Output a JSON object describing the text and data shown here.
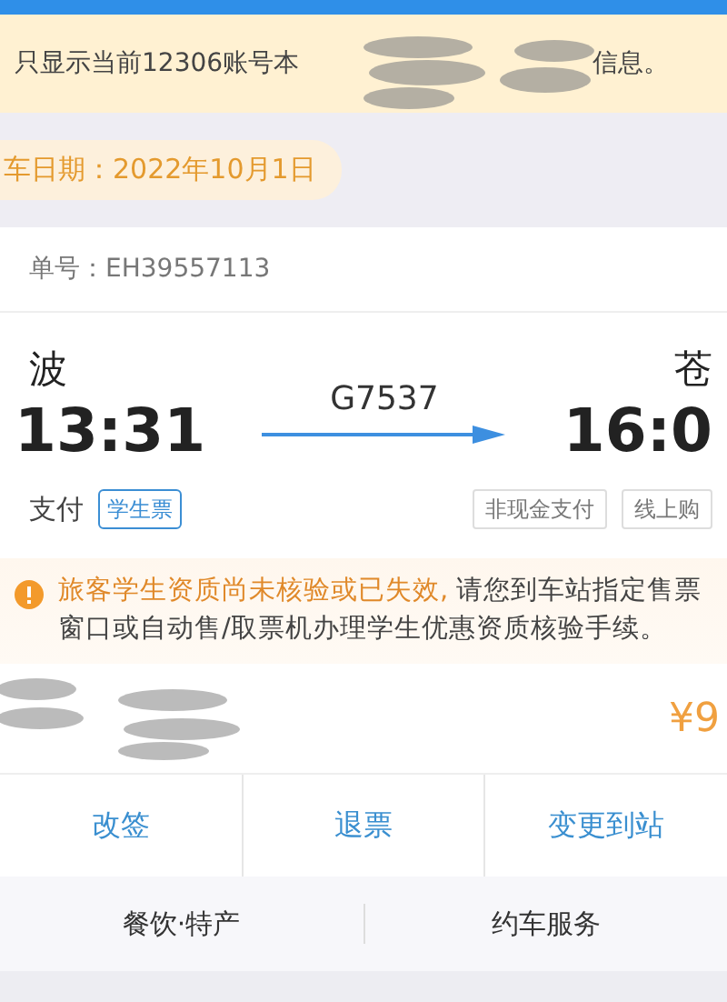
{
  "notice": {
    "text_start": "只显示当前12306账号本",
    "text_end": "信息。"
  },
  "travel_date": "车日期：2022年10月1日",
  "order_number": "单号：EH39557113",
  "trip": {
    "from_station": "波",
    "depart_time": "13:31",
    "train": "G7537",
    "to_station": "苍",
    "arrive_time": "16:0"
  },
  "payment_status": "支付",
  "ticket_type": "学生票",
  "tags": [
    "非现金支付",
    "线上购"
  ],
  "warning": {
    "highlight": "旅客学生资质尚未核验或已失效,",
    "text": " 请您到车站指定售票窗口或自动售/取票机办理学生优惠资质核验手续。"
  },
  "price": "¥9",
  "actions": [
    "改签",
    "退票",
    "变更到站"
  ],
  "services": [
    "餐饮·特产",
    "约车服务"
  ]
}
